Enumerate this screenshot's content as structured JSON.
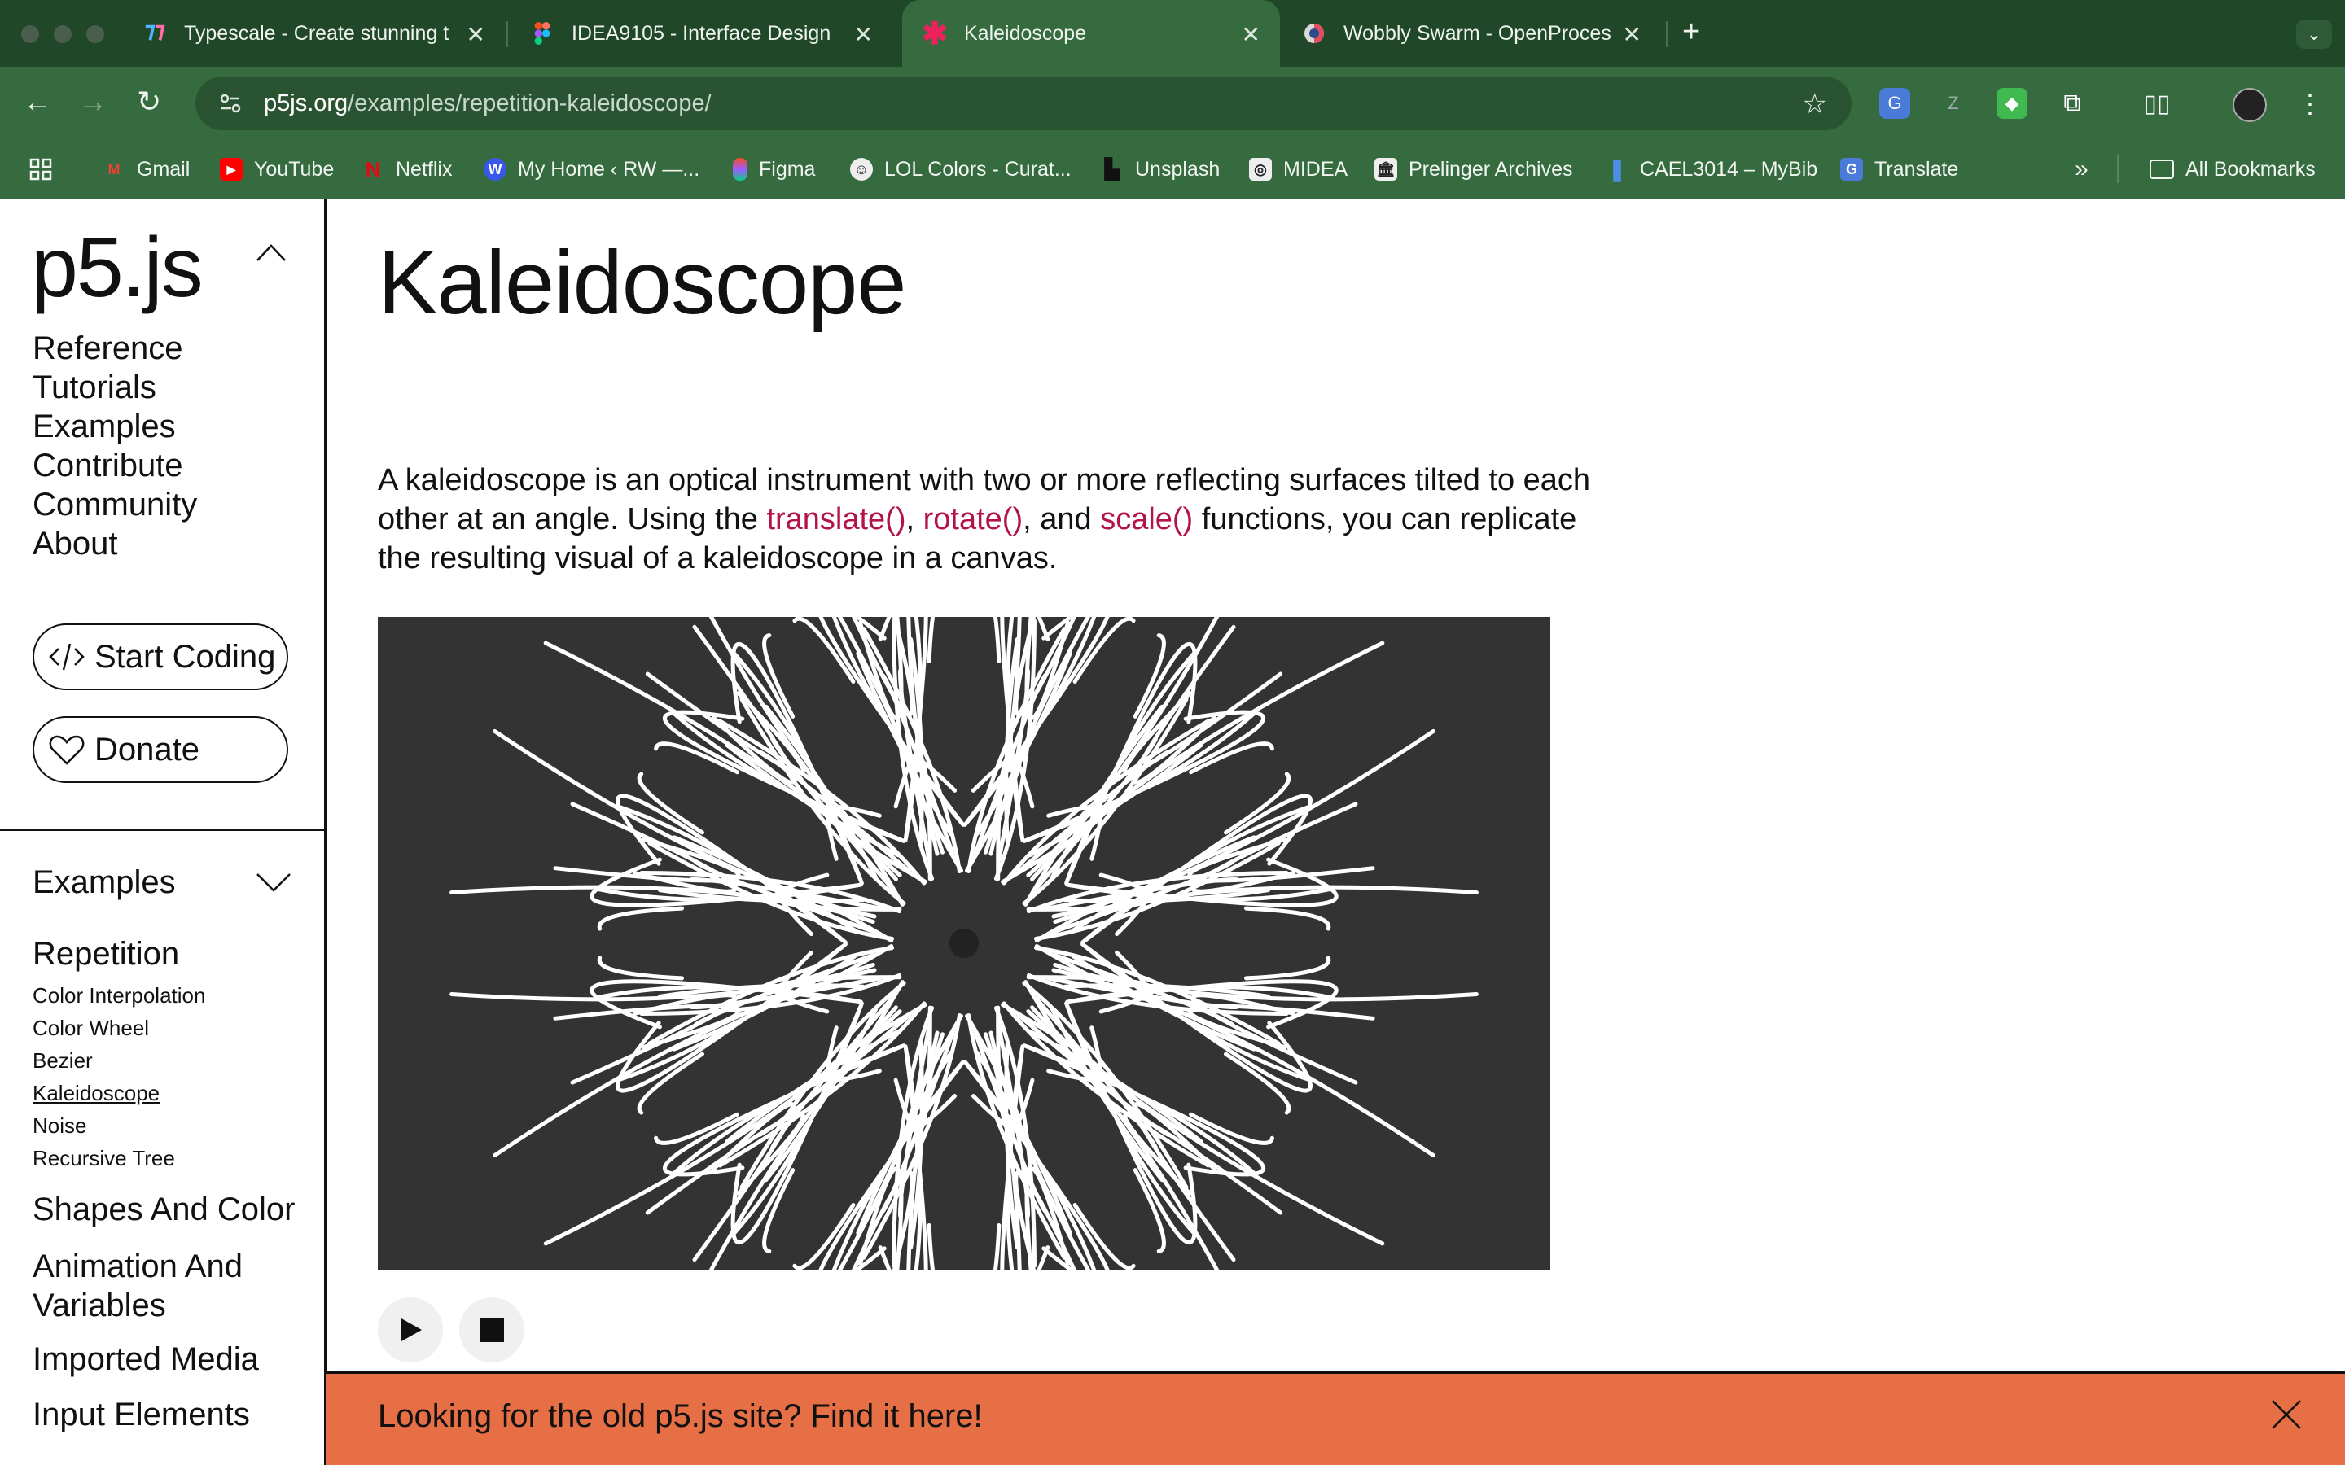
{
  "browser": {
    "tabs": [
      {
        "title": "Typescale - Create stunning t",
        "icon": "typescale-icon",
        "active": false
      },
      {
        "title": "IDEA9105 - Interface Design",
        "icon": "figma-icon",
        "active": false
      },
      {
        "title": "Kaleidoscope",
        "icon": "p5-asterisk-icon",
        "active": true
      },
      {
        "title": "Wobbly Swarm - OpenProces",
        "icon": "openprocessing-icon",
        "active": false
      }
    ],
    "url_domain": "p5js.org",
    "url_path": "/examples/repetition-kaleidoscope/",
    "bookmarks": [
      "Gmail",
      "YouTube",
      "Netflix",
      "My Home ‹ RW —...",
      "Figma",
      "LOL Colors - Curat...",
      "Unsplash",
      "MIDEA",
      "Prelinger Archives",
      "CAEL3014 – MyBib",
      "Translate"
    ],
    "all_bookmarks": "All Bookmarks",
    "overflow": "»"
  },
  "sidebar": {
    "logo": "p5.js",
    "nav": [
      "Reference",
      "Tutorials",
      "Examples",
      "Contribute",
      "Community",
      "About"
    ],
    "start_coding": "Start Coding",
    "donate": "Donate",
    "examples_heading": "Examples",
    "category_current": "Repetition",
    "subitems": [
      "Color Interpolation",
      "Color Wheel",
      "Bezier",
      "Kaleidoscope",
      "Noise",
      "Recursive Tree"
    ],
    "categories": [
      "Shapes And Color",
      "Animation And Variables",
      "Imported Media",
      "Input Elements"
    ]
  },
  "main": {
    "title": "Kaleidoscope",
    "desc_1": "A kaleidoscope is an optical instrument with two or more reflecting surfaces tilted to each other at an angle. Using the ",
    "fn_translate": "translate()",
    "sep_1": ", ",
    "fn_rotate": "rotate()",
    "sep_2": ", and ",
    "fn_scale": "scale()",
    "desc_2": " functions, you can replicate the resulting visual of a kaleidoscope in a canvas."
  },
  "banner": {
    "message": "Looking for the old p5.js site? Find it here!"
  },
  "colors": {
    "browser_dark": "#204727",
    "browser_mid": "#356b3f",
    "accent_function": "#b3124b",
    "canvas_bg": "#333333",
    "banner_bg": "#e76f45"
  }
}
